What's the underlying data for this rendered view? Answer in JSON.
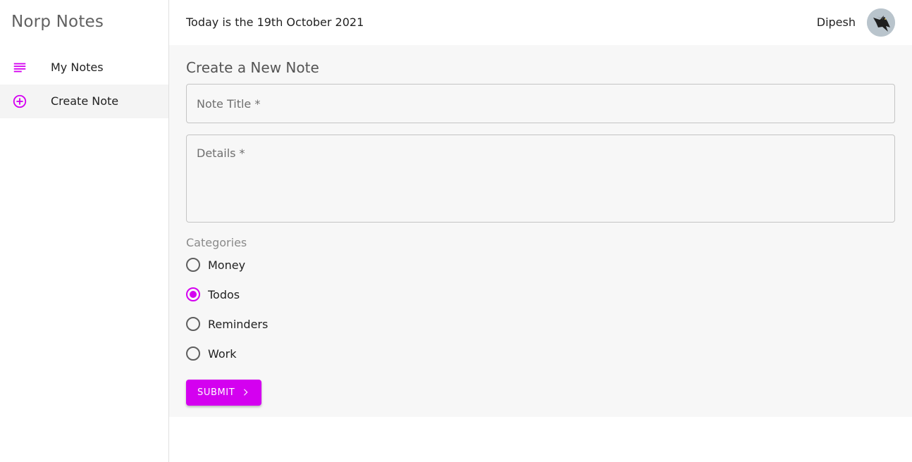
{
  "app": {
    "brand": "Norp Notes"
  },
  "sidebar": {
    "items": [
      {
        "label": "My Notes",
        "icon": "subject-icon",
        "active": false
      },
      {
        "label": "Create Note",
        "icon": "add-circle-icon",
        "active": true
      }
    ]
  },
  "header": {
    "date_text": "Today is the 19th October 2021",
    "username": "Dipesh",
    "avatar_icon": "eagle-avatar"
  },
  "form": {
    "heading": "Create a New Note",
    "title_field": {
      "placeholder": "Note Title *",
      "value": ""
    },
    "details_field": {
      "placeholder": "Details *",
      "value": ""
    },
    "categories_label": "Categories",
    "categories": [
      {
        "label": "Money",
        "checked": false
      },
      {
        "label": "Todos",
        "checked": true
      },
      {
        "label": "Reminders",
        "checked": false
      },
      {
        "label": "Work",
        "checked": false
      }
    ],
    "submit_label": "Submit",
    "submit_icon": "chevron-right-icon"
  },
  "colors": {
    "accent": "#d400f0",
    "main_bg": "#f7f7f7",
    "active_nav_bg": "#f4f4f4"
  }
}
